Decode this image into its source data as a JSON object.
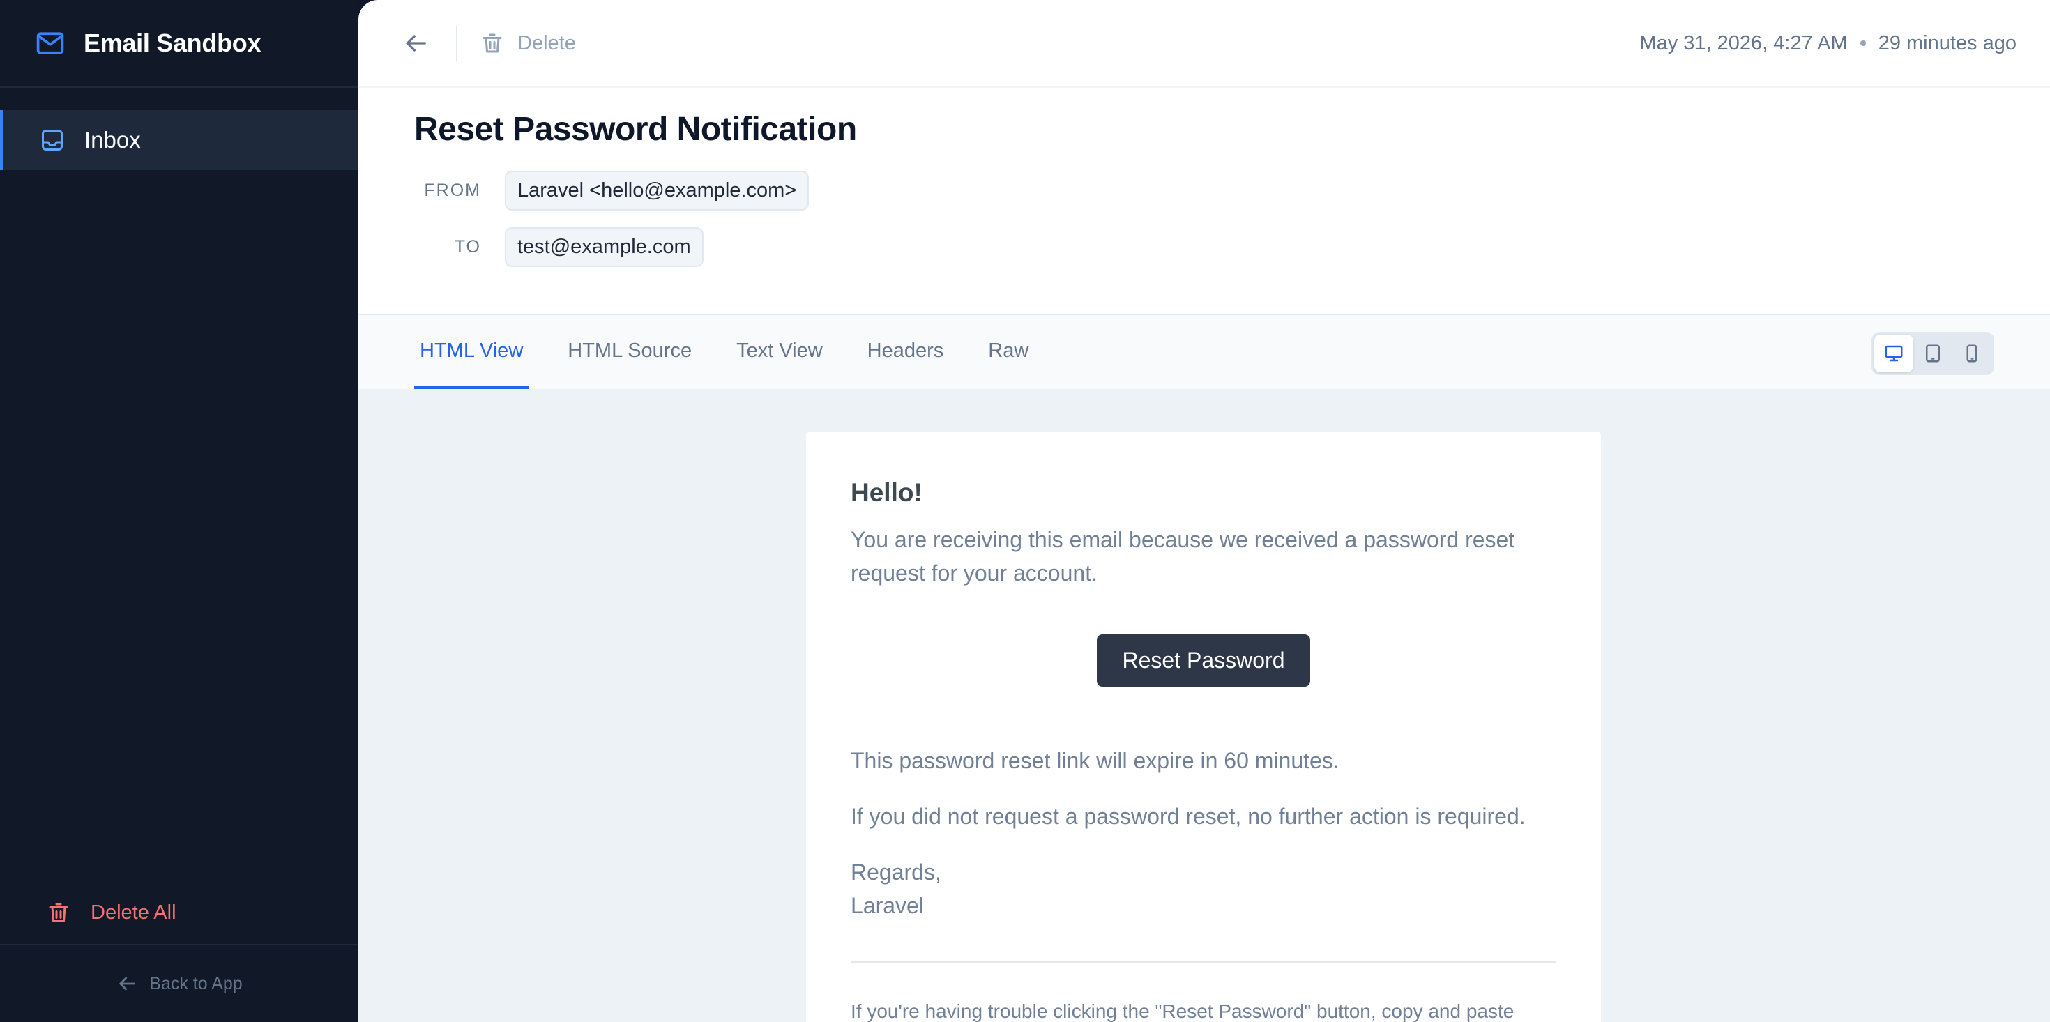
{
  "app": {
    "name": "Email Sandbox"
  },
  "sidebar": {
    "items": [
      {
        "label": "Inbox"
      }
    ],
    "delete_all_label": "Delete All",
    "back_label": "Back to App"
  },
  "toolbar": {
    "delete_label": "Delete",
    "date": "May 31, 2026, 4:27 AM",
    "relative_time": "29 minutes ago"
  },
  "message": {
    "subject": "Reset Password Notification",
    "from_label": "FROM",
    "from": "Laravel <hello@example.com>",
    "to_label": "TO",
    "to": "test@example.com"
  },
  "tabs": [
    {
      "label": "HTML View",
      "active": true
    },
    {
      "label": "HTML Source"
    },
    {
      "label": "Text View"
    },
    {
      "label": "Headers"
    },
    {
      "label": "Raw"
    }
  ],
  "email": {
    "greeting": "Hello!",
    "intro": "You are receiving this email because we received a password reset request for your account.",
    "button": "Reset Password",
    "expiry": "This password reset link will expire in 60 minutes.",
    "no_action": "If you did not request a password reset, no further action is required.",
    "regards": "Regards,",
    "signature": "Laravel",
    "subcopy": "If you're having trouble clicking the \"Reset Password\" button, copy and paste"
  },
  "colors": {
    "accent": "#3b82f6",
    "danger": "#f87171",
    "sidebar_bg": "#111827"
  }
}
